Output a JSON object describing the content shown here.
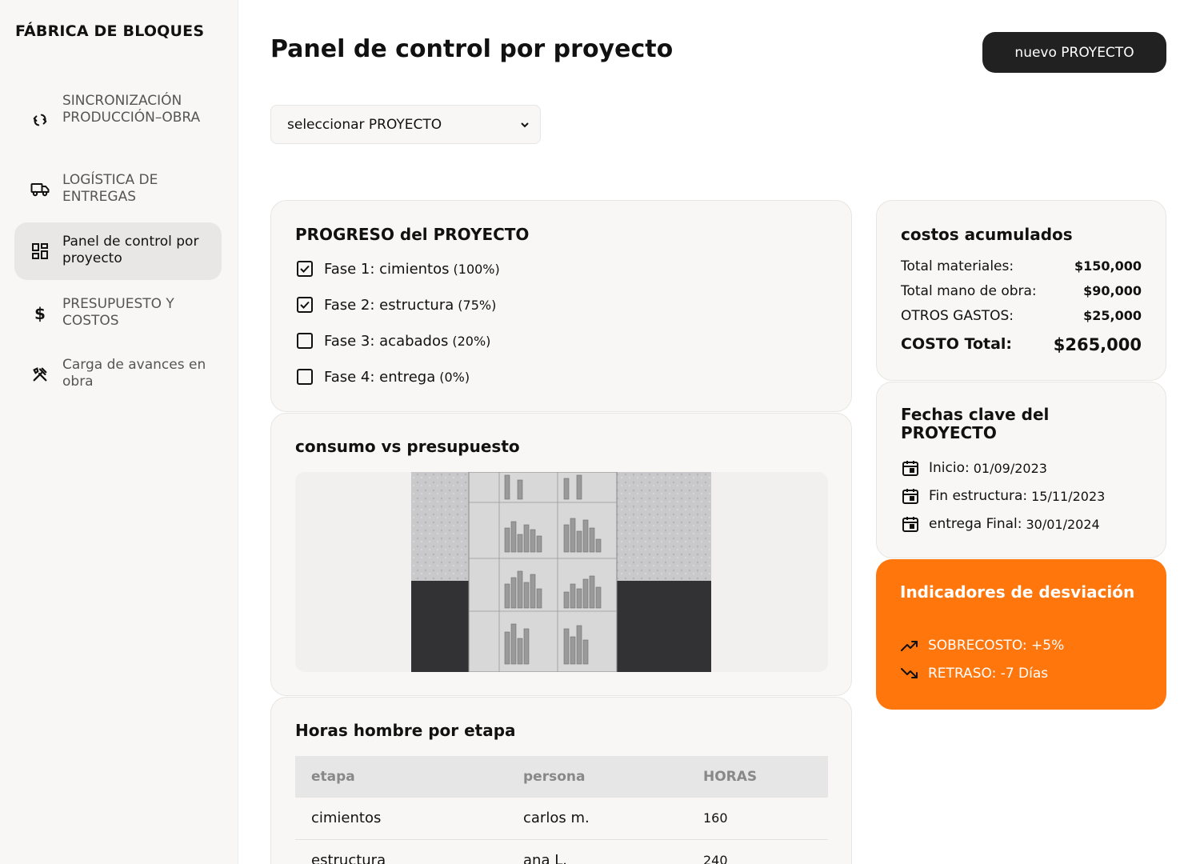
{
  "sidebar": {
    "brand": "FÁBRICA DE BLOQUES",
    "items": [
      {
        "label": "SINCRONIZACIÓN PRODUCCIÓN–OBRA",
        "icon": "sync-icon"
      },
      {
        "label": "LOGÍSTICA DE ENTREGAS",
        "icon": "truck-icon"
      },
      {
        "label": "Panel de control por proyecto",
        "icon": "dashboard-icon",
        "active": true
      },
      {
        "label": "PRESUPUESTO Y COSTOS",
        "icon": "dollar-icon"
      },
      {
        "label": "Carga de avances en obra",
        "icon": "tools-icon"
      }
    ]
  },
  "header": {
    "title": "Panel de control por proyecto",
    "new_button": "nuevo PROYECTO"
  },
  "project_select": {
    "value": "seleccionar PROYECTO"
  },
  "progress": {
    "title": "PROGRESO del PROYECTO",
    "phases": [
      {
        "name": "Fase 1: cimientos",
        "pct": "(100%)",
        "checked": true
      },
      {
        "name": "Fase 2: estructura",
        "pct": "(75%)",
        "checked": true
      },
      {
        "name": "Fase 3: acabados",
        "pct": "(20%)",
        "checked": false
      },
      {
        "name": "Fase 4: entrega",
        "pct": "(0%)",
        "checked": false
      }
    ]
  },
  "consumo": {
    "title": "consumo vs presupuesto"
  },
  "hours": {
    "title": "Horas hombre por etapa",
    "columns": [
      "etapa",
      "persona",
      "HORAS"
    ],
    "rows": [
      [
        "cimientos",
        "carlos m.",
        "160"
      ],
      [
        "estructura",
        "ana L.",
        "240"
      ]
    ]
  },
  "costs": {
    "title": "costos acumulados",
    "rows": [
      {
        "label": "Total materiales:",
        "value": "$150,000"
      },
      {
        "label": "Total mano de obra:",
        "value": "$90,000"
      },
      {
        "label": "OTROS GASTOS:",
        "value": "$25,000"
      }
    ],
    "total_label": "COSTO Total:",
    "total_value": "$265,000"
  },
  "dates": {
    "title": "Fechas clave del PROYECTO",
    "rows": [
      {
        "label": "Inicio:",
        "date": "01/09/2023"
      },
      {
        "label": "Fin estructura:",
        "date": "15/11/2023"
      },
      {
        "label": "entrega Final:",
        "date": "30/01/2024"
      }
    ]
  },
  "deviation": {
    "title": "Indicadores de desviación",
    "rows": [
      {
        "label": "SOBRECOSTO: +5%",
        "icon": "trend-up-icon"
      },
      {
        "label": "RETRASO: -7 Días",
        "icon": "trend-down-icon"
      }
    ]
  },
  "colors": {
    "accent": "#ff760d",
    "dark_button": "#212121",
    "card_bg": "#f8f7f5"
  }
}
